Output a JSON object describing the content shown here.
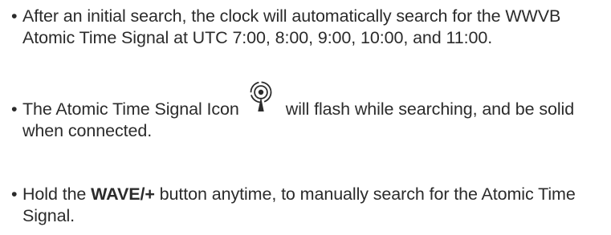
{
  "bullets": [
    {
      "marker": "•",
      "text": "After an initial search, the clock will automatically search for the WWVB Atomic Time Signal at UTC 7:00, 8:00, 9:00, 10:00, and 11:00."
    },
    {
      "marker": "•",
      "text_before_icon": "The Atomic Time Signal Icon",
      "icon": "atomic-time-signal-icon",
      "text_after_icon": "will flash while searching, and be solid when connected."
    },
    {
      "marker": "•",
      "text_before_bold": "Hold the ",
      "bold_text": "WAVE/+",
      "text_after_bold": " button anytime, to manually search for the Atomic Time Signal."
    }
  ]
}
